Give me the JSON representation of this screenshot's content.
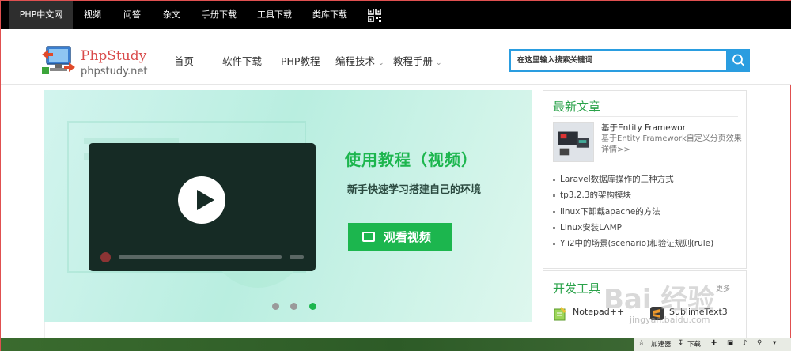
{
  "topnav": {
    "items": [
      "PHP中文网",
      "视频",
      "问答",
      "杂文",
      "手册下载",
      "工具下载",
      "类库下载"
    ],
    "qr_icon": "qrcode-icon"
  },
  "header": {
    "logo_title": "PhpStudy",
    "logo_domain": "phpstudy.net",
    "nav": [
      "首页",
      "软件下载",
      "PHP教程",
      "编程技术",
      "教程手册"
    ],
    "search_placeholder": "在这里输入搜索关键词"
  },
  "banner": {
    "title": "使用教程（视频）",
    "subtitle": "新手快速学习搭建自己的环境",
    "button": "观看视频"
  },
  "sidebar": {
    "latest_title": "最新文章",
    "featured_title": "基于Entity Framewor",
    "featured_desc": "基于Entity Framework自定义分页效果详情>>",
    "list": [
      "Laravel数据库操作的三种方式",
      "tp3.2.3的架构模块",
      "linux下卸载apache的方法",
      "Linux安装LAMP",
      "Yii2中的场景(scenario)和验证规则(rule)"
    ],
    "tools_title": "开发工具",
    "tools_more": "更多",
    "tools": [
      "Notepad++",
      "SublimeText3"
    ]
  },
  "watermark": {
    "main": "Bai 经验",
    "sub": "jingyan.baidu.com"
  },
  "taskbar": {
    "items": [
      "加速器",
      "下载"
    ]
  }
}
